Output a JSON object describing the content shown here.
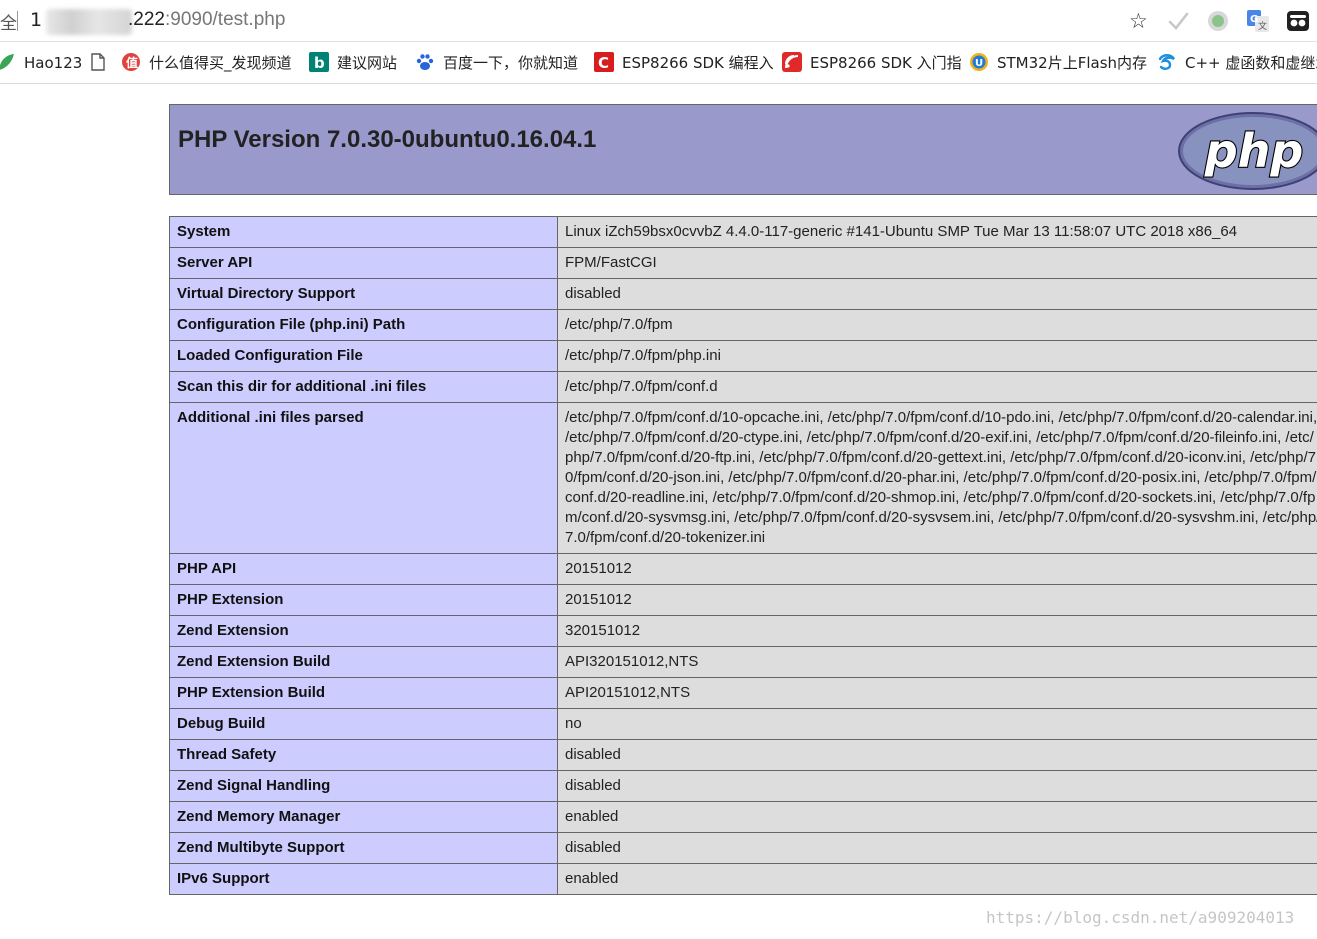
{
  "browser": {
    "secure_glyph": "全",
    "url_prefix": "1",
    "url_host_visible": ".222",
    "url_port_path": ":9090/test.php",
    "bookmarks": [
      {
        "label": "Hao123",
        "icon": "leaf-icon"
      },
      {
        "label": "",
        "icon": "page-icon"
      },
      {
        "label": "什么值得买_发现频道",
        "icon": "zhidemai-icon"
      },
      {
        "label": "建议网站",
        "icon": "bing-icon"
      },
      {
        "label": "百度一下，你就知道",
        "icon": "baidu-paw-icon"
      },
      {
        "label": "ESP8266 SDK 编程入",
        "icon": "csdn-icon"
      },
      {
        "label": "ESP8266 SDK 入门指",
        "icon": "espressif-icon"
      },
      {
        "label": "STM32片上Flash内存",
        "icon": "u-circle-icon"
      },
      {
        "label": "C++ 虚函数和虚继承",
        "icon": "swirl-icon"
      }
    ]
  },
  "php": {
    "title": "PHP Version 7.0.30-0ubuntu0.16.04.1",
    "logo_text": "php",
    "rows": [
      {
        "key": "System",
        "value": "Linux iZch59bsx0cvvbZ 4.4.0-117-generic #141-Ubuntu SMP Tue Mar 13 11:58:07 UTC 2018 x86_64"
      },
      {
        "key": "Server API",
        "value": "FPM/FastCGI"
      },
      {
        "key": "Virtual Directory Support",
        "value": "disabled"
      },
      {
        "key": "Configuration File (php.ini) Path",
        "value": "/etc/php/7.0/fpm"
      },
      {
        "key": "Loaded Configuration File",
        "value": "/etc/php/7.0/fpm/php.ini"
      },
      {
        "key": "Scan this dir for additional .ini files",
        "value": "/etc/php/7.0/fpm/conf.d"
      },
      {
        "key": "Additional .ini files parsed",
        "value": "/etc/php/7.0/fpm/conf.d/10-opcache.ini, /etc/php/7.0/fpm/conf.d/10-pdo.ini, /etc/php/7.0/fpm/conf.d/20-calendar.ini, /etc/php/7.0/fpm/conf.d/20-ctype.ini, /etc/php/7.0/fpm/conf.d/20-exif.ini, /etc/php/7.0/fpm/conf.d/20-fileinfo.ini, /etc/php/7.0/fpm/conf.d/20-ftp.ini, /etc/php/7.0/fpm/conf.d/20-gettext.ini, /etc/php/7.0/fpm/conf.d/20-iconv.ini, /etc/php/7.0/fpm/conf.d/20-json.ini, /etc/php/7.0/fpm/conf.d/20-phar.ini, /etc/php/7.0/fpm/conf.d/20-posix.ini, /etc/php/7.0/fpm/conf.d/20-readline.ini, /etc/php/7.0/fpm/conf.d/20-shmop.ini, /etc/php/7.0/fpm/conf.d/20-sockets.ini, /etc/php/7.0/fpm/conf.d/20-sysvmsg.ini, /etc/php/7.0/fpm/conf.d/20-sysvsem.ini, /etc/php/7.0/fpm/conf.d/20-sysvshm.ini, /etc/php/7.0/fpm/conf.d/20-tokenizer.ini"
      },
      {
        "key": "PHP API",
        "value": "20151012"
      },
      {
        "key": "PHP Extension",
        "value": "20151012"
      },
      {
        "key": "Zend Extension",
        "value": "320151012"
      },
      {
        "key": "Zend Extension Build",
        "value": "API320151012,NTS"
      },
      {
        "key": "PHP Extension Build",
        "value": "API20151012,NTS"
      },
      {
        "key": "Debug Build",
        "value": "no"
      },
      {
        "key": "Thread Safety",
        "value": "disabled"
      },
      {
        "key": "Zend Signal Handling",
        "value": "disabled"
      },
      {
        "key": "Zend Memory Manager",
        "value": "enabled"
      },
      {
        "key": "Zend Multibyte Support",
        "value": "disabled"
      },
      {
        "key": "IPv6 Support",
        "value": "enabled"
      }
    ]
  },
  "watermark": "https://blog.csdn.net/a909204013",
  "colors": {
    "header_bg": "#9999cc",
    "key_bg": "#ccccff",
    "value_bg": "#dddddd",
    "border": "#666666"
  }
}
